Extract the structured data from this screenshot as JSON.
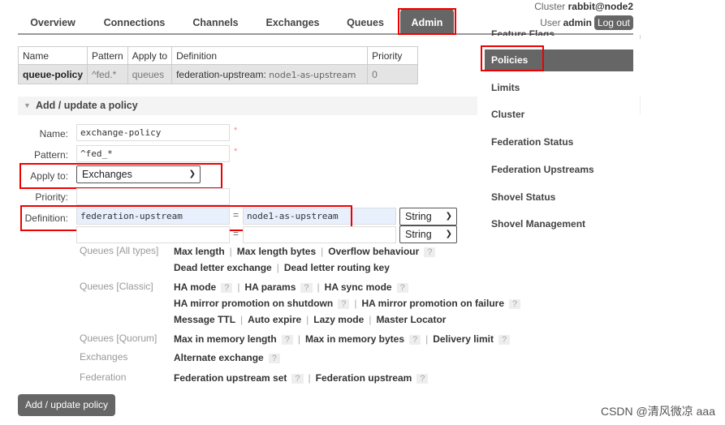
{
  "header": {
    "cluster_label": "Cluster",
    "cluster": "rabbit@node2",
    "user_label": "User",
    "user": "admin",
    "logout": "Log out"
  },
  "tabs": [
    "Overview",
    "Connections",
    "Channels",
    "Exchanges",
    "Queues",
    "Admin"
  ],
  "active_tab": "Admin",
  "sidebar": {
    "partial": "Feature Flags",
    "items": [
      "Policies",
      "Limits",
      "Cluster",
      "Federation Status",
      "Federation Upstreams",
      "Shovel Status",
      "Shovel Management"
    ],
    "active": "Policies"
  },
  "table": {
    "headers": [
      "Name",
      "Pattern",
      "Apply to",
      "Definition",
      "Priority"
    ],
    "rows": [
      {
        "name": "queue-policy",
        "pattern": "^fed.*",
        "apply_to": "queues",
        "def_key": "federation-upstream:",
        "def_value": "node1-as-upstream",
        "priority": "0"
      }
    ]
  },
  "form": {
    "section_title": "Add / update a policy",
    "name_label": "Name:",
    "name": "exchange-policy",
    "pattern_label": "Pattern:",
    "pattern": "^fed_*",
    "apply_label": "Apply to:",
    "apply": "Exchanges",
    "priority_label": "Priority:",
    "priority": "",
    "definition_label": "Definition:",
    "def_key": "federation-upstream",
    "def_value": "node1-as-upstream",
    "eq": "=",
    "type": "String",
    "type2": "String",
    "required": "*",
    "submit": "Add / update policy"
  },
  "help": [
    {
      "group": "Queues [All types]",
      "lines": [
        [
          {
            "t": "Max length"
          },
          {
            "t": "Max length bytes"
          },
          {
            "t": "Overflow behaviour",
            "q": true
          }
        ],
        [
          {
            "t": "Dead letter exchange"
          },
          {
            "t": "Dead letter routing key"
          }
        ]
      ]
    },
    {
      "group": "Queues [Classic]",
      "lines": [
        [
          {
            "t": "HA mode",
            "q": true
          },
          {
            "t": "HA params",
            "q": true
          },
          {
            "t": "HA sync mode",
            "q": true
          }
        ],
        [
          {
            "t": "HA mirror promotion on shutdown",
            "q": true
          },
          {
            "t": "HA mirror promotion on failure",
            "q": true
          }
        ],
        [
          {
            "t": "Message TTL"
          },
          {
            "t": "Auto expire"
          },
          {
            "t": "Lazy mode"
          },
          {
            "t": "Master Locator"
          }
        ]
      ]
    },
    {
      "group": "Queues [Quorum]",
      "lines": [
        [
          {
            "t": "Max in memory length",
            "q": true
          },
          {
            "t": "Max in memory bytes",
            "q": true
          },
          {
            "t": "Delivery limit",
            "q": true
          }
        ]
      ]
    },
    {
      "group": "Exchanges",
      "lines": [
        [
          {
            "t": "Alternate exchange",
            "q": true
          }
        ]
      ]
    },
    {
      "group": "Federation",
      "lines": [
        [
          {
            "t": "Federation upstream set",
            "q": true
          },
          {
            "t": "Federation upstream",
            "q": true
          }
        ]
      ]
    }
  ],
  "watermark": "CSDN @清风微凉 aaa",
  "colors": {
    "accent": "#666666",
    "highlight": "#e00000"
  }
}
